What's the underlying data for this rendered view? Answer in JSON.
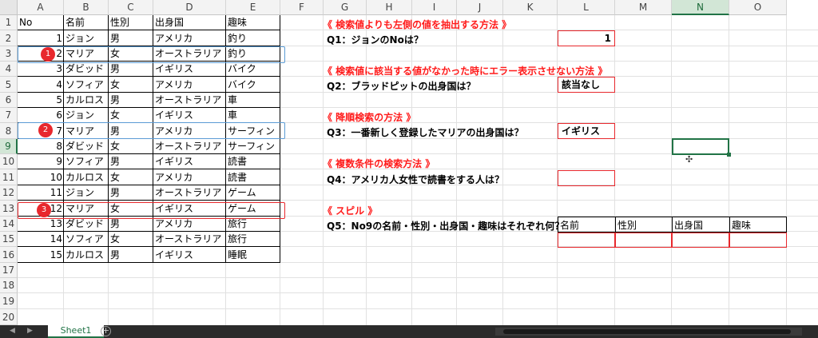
{
  "columns": [
    "A",
    "B",
    "C",
    "D",
    "E",
    "F",
    "G",
    "H",
    "I",
    "J",
    "K",
    "L",
    "M",
    "N",
    "O"
  ],
  "selected_column": "N",
  "rows": [
    "1",
    "2",
    "3",
    "4",
    "5",
    "6",
    "7",
    "8",
    "9",
    "10",
    "11",
    "12",
    "13",
    "14",
    "15",
    "16",
    "17",
    "18",
    "19",
    "20"
  ],
  "selected_row": "9",
  "table": {
    "headers": [
      "No",
      "名前",
      "性別",
      "出身国",
      "趣味"
    ],
    "records": [
      [
        "1",
        "ジョン",
        "男",
        "アメリカ",
        "釣り"
      ],
      [
        "2",
        "マリア",
        "女",
        "オーストラリア",
        "釣り"
      ],
      [
        "3",
        "ダビッド",
        "男",
        "イギリス",
        "バイク"
      ],
      [
        "4",
        "ソフィア",
        "女",
        "アメリカ",
        "バイク"
      ],
      [
        "5",
        "カルロス",
        "男",
        "オーストラリア",
        "車"
      ],
      [
        "6",
        "ジョン",
        "女",
        "イギリス",
        "車"
      ],
      [
        "7",
        "マリア",
        "男",
        "アメリカ",
        "サーフィン"
      ],
      [
        "8",
        "ダビッド",
        "女",
        "オーストラリア",
        "サーフィン"
      ],
      [
        "9",
        "ソフィア",
        "男",
        "イギリス",
        "読書"
      ],
      [
        "10",
        "カルロス",
        "女",
        "アメリカ",
        "読書"
      ],
      [
        "11",
        "ジョン",
        "男",
        "オーストラリア",
        "ゲーム"
      ],
      [
        "12",
        "マリア",
        "女",
        "イギリス",
        "ゲーム"
      ],
      [
        "13",
        "ダビッド",
        "男",
        "アメリカ",
        "旅行"
      ],
      [
        "14",
        "ソフィア",
        "女",
        "オーストラリア",
        "旅行"
      ],
      [
        "15",
        "カルロス",
        "男",
        "イギリス",
        "睡眠"
      ]
    ]
  },
  "badges": [
    "1",
    "2",
    "3"
  ],
  "sections": {
    "s1": "《 検索値よりも左側の値を抽出する方法 》",
    "s2": "《 検索値に該当する値がなかった時にエラー表示させない方法 》",
    "s3": "《 降順検索の方法 》",
    "s4": "《 複数条件の検索方法 》",
    "s5": "《 スピル 》"
  },
  "questions": {
    "q1": "Q1：ジョンのNoは？",
    "q2": "Q2：ブラッドピットの出身国は？",
    "q3": "Q3：一番新しく登録したマリアの出身国は？",
    "q4": "Q4：アメリカ人女性で読書をする人は？",
    "q5": "Q5：No9の名前・性別・出身国・趣味はそれぞれ何？"
  },
  "answers": {
    "a1": "1",
    "a2": "該当なし",
    "a3": "イギリス",
    "a4": ""
  },
  "q5_headers": [
    "名前",
    "性別",
    "出身国",
    "趣味"
  ],
  "sheet_tab": "Sheet1",
  "add_sheet": "+",
  "nav": {
    "prev": "◀",
    "next": "▶"
  },
  "colors": {
    "accent": "#217346",
    "red": "#e8282d",
    "blue_box": "#5b9bd5"
  }
}
